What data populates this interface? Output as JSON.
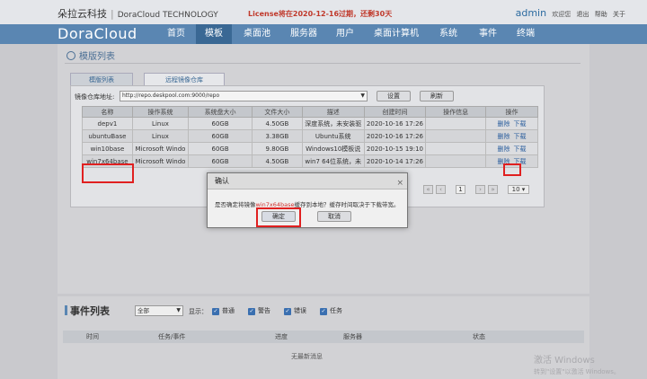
{
  "header": {
    "brand": "朵拉云科技",
    "brand_en": "DoraCloud TECHNOLOGY",
    "license_notice": "License将在2020-12-16过期，还剩30天",
    "username": "admin",
    "links": [
      "欢迎您",
      "退出",
      "帮助",
      "关于"
    ]
  },
  "nav": {
    "logo": "DoraCloud",
    "items": [
      "首页",
      "模板",
      "桌面池",
      "服务器",
      "用户",
      "桌面计算机",
      "系统",
      "事件",
      "终端"
    ],
    "active": "模板"
  },
  "panel": {
    "title": "模版列表",
    "tabs": [
      "模版列表",
      "远程镜像仓库"
    ],
    "active_tab": "远程镜像仓库"
  },
  "repo": {
    "label": "镜像仓库地址:",
    "url": "http://repo.deskpool.com:9000/repo",
    "settings_button": "设置",
    "refresh_button": "刷新"
  },
  "table": {
    "columns": [
      "名称",
      "操作系统",
      "系统盘大小",
      "文件大小",
      "描述",
      "创建时间",
      "操作信息",
      "操作"
    ],
    "rows": [
      {
        "name": "depv1",
        "os": "Linux",
        "disk": "60GB",
        "size": "4.50GB",
        "desc": "深度系统，未安装驱",
        "created": "2020-10-16 17:26",
        "info": "",
        "delete": "删除",
        "download": "下载"
      },
      {
        "name": "ubuntuBase",
        "os": "Linux",
        "disk": "60GB",
        "size": "3.38GB",
        "desc": "Ubuntu系统",
        "created": "2020-10-16 17:26",
        "info": "",
        "delete": "删除",
        "download": "下载"
      },
      {
        "name": "win10base",
        "os": "Microsoft Windo",
        "disk": "60GB",
        "size": "9.80GB",
        "desc": "Windows10模板说",
        "created": "2020-10-15 19:10",
        "info": "",
        "delete": "删除",
        "download": "下载"
      },
      {
        "name": "win7x64base",
        "os": "Microsoft Windo",
        "disk": "60GB",
        "size": "4.50GB",
        "desc": "win7 64位系统，未",
        "created": "2020-10-14 17:26",
        "info": "",
        "delete": "删除",
        "download": "下载"
      }
    ]
  },
  "pager": {
    "first": "«",
    "prev": "‹",
    "current": "1",
    "next": "›",
    "last": "»",
    "page_size": "10"
  },
  "dialog": {
    "title": "确认",
    "close": "×",
    "msg_prefix": "是否确定将镜像",
    "msg_highlight": "win7x64base",
    "msg_suffix": "缓存到本地？缓存时间取决于下载带宽。",
    "ok": "确定",
    "cancel": "取消"
  },
  "events": {
    "title": "事件列表",
    "filter_value": "全部",
    "show_label": "显示：",
    "checkboxes": [
      "普通",
      "警告",
      "错误",
      "任务"
    ],
    "columns": [
      "时间",
      "任务/事件",
      "进度",
      "服务器",
      "状态"
    ],
    "empty": "无最新消息"
  },
  "watermark": {
    "line1": "激活 Windows",
    "line2": "转到\"设置\"以激活 Windows。"
  }
}
